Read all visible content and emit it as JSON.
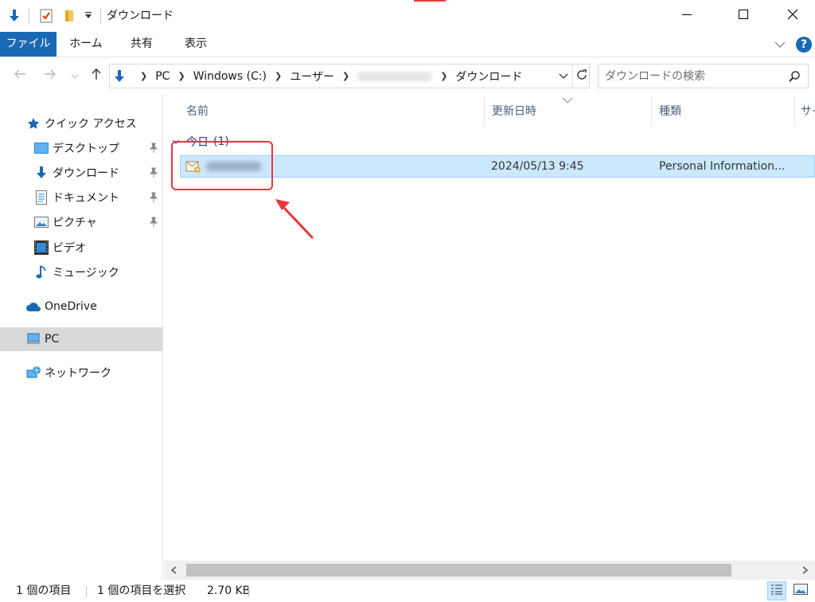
{
  "window": {
    "title": "ダウンロード",
    "controls": {
      "minimize_icon": "minimize-icon",
      "maximize_icon": "maximize-icon",
      "close_icon": "close-icon"
    }
  },
  "ribbon": {
    "tabs": [
      {
        "label": "ファイル",
        "active": true
      },
      {
        "label": "ホーム"
      },
      {
        "label": "共有"
      },
      {
        "label": "表示"
      }
    ],
    "help_label": "?"
  },
  "address": {
    "crumbs": [
      {
        "label": "PC"
      },
      {
        "label": "Windows (C:)"
      },
      {
        "label": "ユーザー"
      },
      {
        "label": "ダウンロード"
      }
    ]
  },
  "search": {
    "placeholder": "ダウンロードの検索"
  },
  "sidebar": {
    "quick_access": "クイック アクセス",
    "items": [
      {
        "label": "デスクトップ",
        "pinned": true
      },
      {
        "label": "ダウンロード",
        "pinned": true
      },
      {
        "label": "ドキュメント",
        "pinned": true
      },
      {
        "label": "ピクチャ",
        "pinned": true
      },
      {
        "label": "ビデオ",
        "pinned": false
      },
      {
        "label": "ミュージック",
        "pinned": false
      }
    ],
    "onedrive": "OneDrive",
    "pc": "PC",
    "network": "ネットワーク"
  },
  "columns": [
    {
      "label": "名前"
    },
    {
      "label": "更新日時"
    },
    {
      "label": "種類"
    },
    {
      "label": "サイ"
    }
  ],
  "group": {
    "label": "今日",
    "count": "(1)"
  },
  "files": [
    {
      "modified": "2024/05/13 9:45",
      "type": "Personal Information..."
    }
  ],
  "status": {
    "item_count": "1 個の項目",
    "selected": "1 個の項目を選択",
    "size": "2.70 KB"
  },
  "colors": {
    "accent": "#1a69b5",
    "selection": "#cce8ff",
    "annotation": "#e8363b"
  }
}
